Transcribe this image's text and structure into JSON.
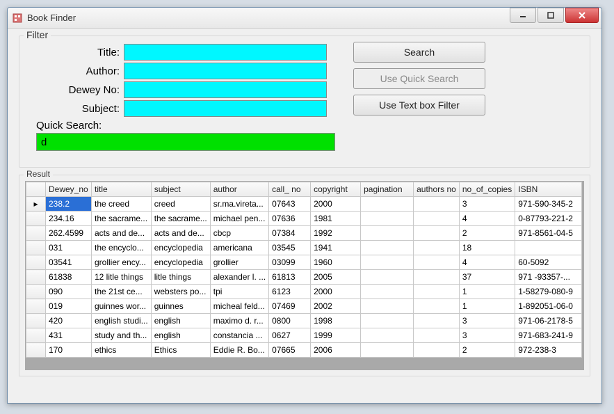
{
  "window": {
    "title": "Book Finder"
  },
  "filter": {
    "legend": "Filter",
    "title_label": "Title:",
    "author_label": "Author:",
    "dewey_label": "Dewey No:",
    "subject_label": "Subject:",
    "quicksearch_label": "Quick Search:",
    "title_value": "",
    "author_value": "",
    "dewey_value": "",
    "subject_value": "",
    "quicksearch_value": "d"
  },
  "buttons": {
    "search": "Search",
    "use_quick": "Use Quick Search",
    "use_textbox": "Use Text box Filter"
  },
  "result": {
    "legend": "Result",
    "columns": [
      "Dewey_no",
      "title",
      "subject",
      "author",
      "call_ no",
      "copyright",
      "pagination",
      "authors no",
      "no_of_copies",
      "ISBN"
    ],
    "rows": [
      {
        "dewey": "238.2",
        "title": "the creed",
        "subject": "creed",
        "author": "sr.ma.vireta...",
        "call": "07643",
        "copy": "2000",
        "pag": "",
        "authno": "",
        "copies": "3",
        "isbn": "971-590-345-2",
        "selected": true,
        "current": true
      },
      {
        "dewey": "234.16",
        "title": "the sacrame...",
        "subject": "the sacrame...",
        "author": "michael pen...",
        "call": "07636",
        "copy": "1981",
        "pag": "",
        "authno": "",
        "copies": "4",
        "isbn": "0-87793-221-2"
      },
      {
        "dewey": "262.4599",
        "title": "acts and de...",
        "subject": "acts and de...",
        "author": "cbcp",
        "call": "07384",
        "copy": "1992",
        "pag": "",
        "authno": "",
        "copies": "2",
        "isbn": "971-8561-04-5"
      },
      {
        "dewey": "031",
        "title": "the encyclo...",
        "subject": "encyclopedia",
        "author": "americana",
        "call": "03545",
        "copy": "1941",
        "pag": "",
        "authno": "",
        "copies": "18",
        "isbn": ""
      },
      {
        "dewey": "03541",
        "title": "grollier ency...",
        "subject": "encyclopedia",
        "author": "grollier",
        "call": "03099",
        "copy": "1960",
        "pag": "",
        "authno": "",
        "copies": "4",
        "isbn": "60-5092"
      },
      {
        "dewey": "61838",
        "title": "12 litle things",
        "subject": "litle things",
        "author": "alexander l. ...",
        "call": "61813",
        "copy": "2005",
        "pag": "",
        "authno": "",
        "copies": "37",
        "isbn": "971 -93357-..."
      },
      {
        "dewey": "090",
        "title": "the 21st ce...",
        "subject": "websters po...",
        "author": "tpi",
        "call": "6123",
        "copy": "2000",
        "pag": "",
        "authno": "",
        "copies": "1",
        "isbn": "1-58279-080-9"
      },
      {
        "dewey": "019",
        "title": "guinnes wor...",
        "subject": "guinnes",
        "author": "micheal feld...",
        "call": "07469",
        "copy": "2002",
        "pag": "",
        "authno": "",
        "copies": "1",
        "isbn": "1-892051-06-0"
      },
      {
        "dewey": "420",
        "title": "english studi...",
        "subject": "english",
        "author": "maximo d. r...",
        "call": "0800",
        "copy": "1998",
        "pag": "",
        "authno": "",
        "copies": "3",
        "isbn": "971-06-2178-5"
      },
      {
        "dewey": "431",
        "title": "study and th...",
        "subject": "english",
        "author": "constancia ...",
        "call": "0627",
        "copy": "1999",
        "pag": "",
        "authno": "",
        "copies": "3",
        "isbn": "971-683-241-9"
      },
      {
        "dewey": "170",
        "title": "ethics",
        "subject": "Ethics",
        "author": "Eddie R. Bo...",
        "call": "07665",
        "copy": "2006",
        "pag": "",
        "authno": "",
        "copies": "2",
        "isbn": "972-238-3"
      }
    ]
  }
}
